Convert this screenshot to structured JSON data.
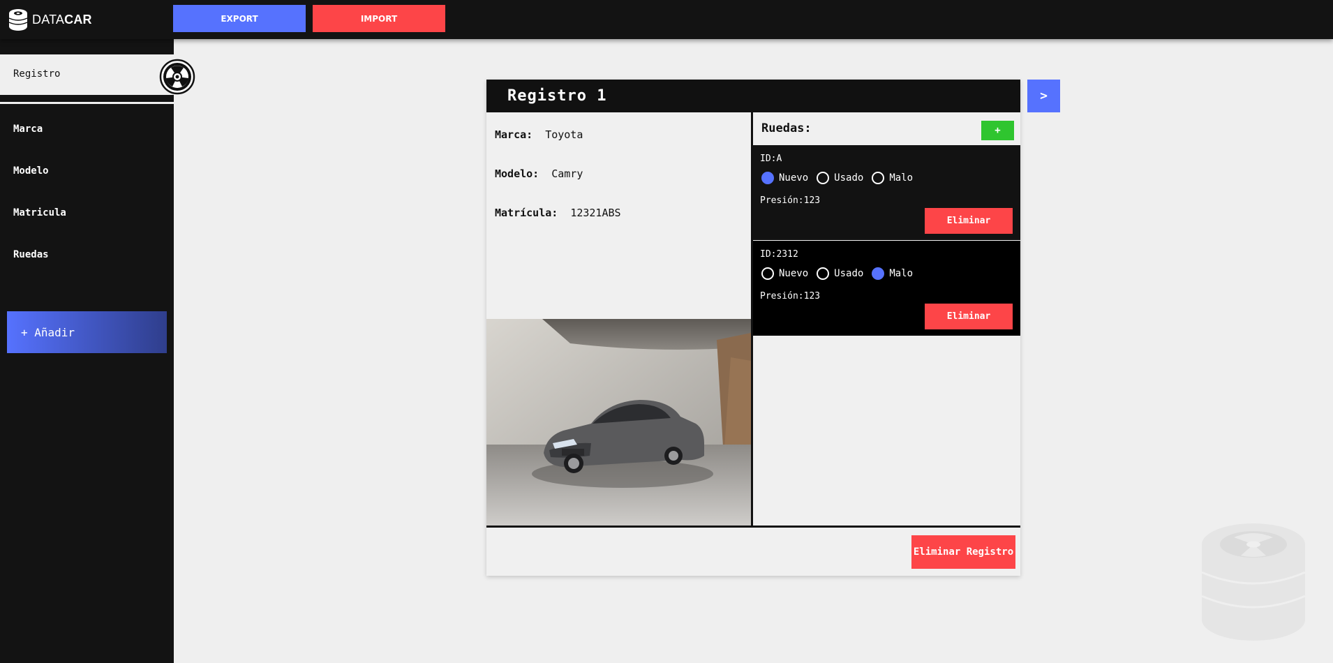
{
  "app": {
    "logo_light": "DATA",
    "logo_bold": "CAR"
  },
  "topbar": {
    "export_label": "EXPORT",
    "import_label": "IMPORT"
  },
  "sidebar": {
    "active_item": "Registro",
    "items": [
      {
        "label": "Marca"
      },
      {
        "label": "Modelo"
      },
      {
        "label": "Matricula"
      },
      {
        "label": "Ruedas"
      }
    ],
    "add_label": "+ Añadir"
  },
  "record": {
    "title": "Registro 1",
    "next_label": ">",
    "fields": {
      "marca_label": "Marca:",
      "marca_value": "Toyota",
      "modelo_label": "Modelo:",
      "modelo_value": "Camry",
      "matricula_label": "Matrícula:",
      "matricula_value": "12321ABS"
    },
    "ruedas_title": "Ruedas:",
    "add_wheel_label": "+",
    "wheels": [
      {
        "id_label": "ID:",
        "id_value": "A",
        "options": [
          "Nuevo",
          "Usado",
          "Malo"
        ],
        "selected": "Nuevo",
        "presion_label": "Presión:",
        "presion_value": "123",
        "delete_label": "Eliminar",
        "bg_color": "#121212"
      },
      {
        "id_label": "ID:",
        "id_value": "2312",
        "options": [
          "Nuevo",
          "Usado",
          "Malo"
        ],
        "selected": "Malo",
        "presion_label": "Presión:",
        "presion_value": "123",
        "delete_label": "Eliminar",
        "bg_color": "#000000"
      }
    ],
    "delete_record_label": "Eliminar Registro"
  },
  "colors": {
    "accent_blue": "#5672fe",
    "danger_red": "#fd4548",
    "success_green": "#2fc52f",
    "dark": "#131313",
    "light_bg": "#efefef"
  },
  "icons": {
    "logo": "tire-stack-icon",
    "wheel_badge": "wheel-icon",
    "watermark": "tire-stack-icon"
  }
}
